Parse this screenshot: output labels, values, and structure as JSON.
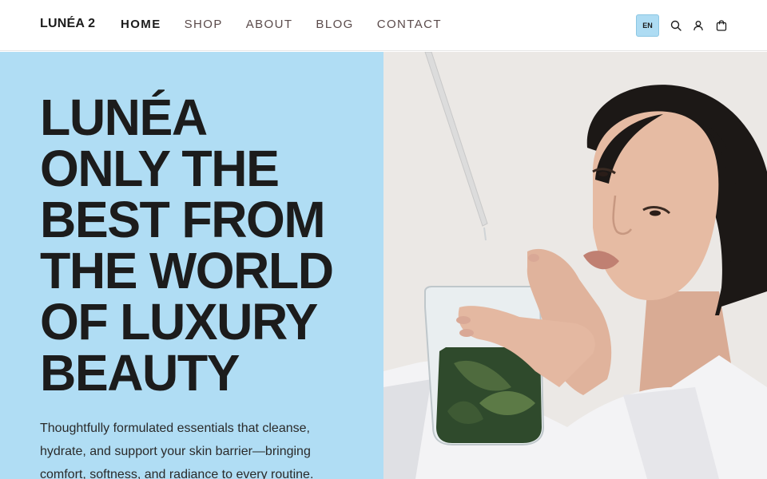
{
  "header": {
    "logo": "LUNÉA 2",
    "nav": [
      {
        "label": "HOME",
        "active": true
      },
      {
        "label": "SHOP",
        "active": false
      },
      {
        "label": "ABOUT",
        "active": false
      },
      {
        "label": "BLOG",
        "active": false
      },
      {
        "label": "CONTACT",
        "active": false
      }
    ],
    "language": "EN",
    "icons": [
      "search-icon",
      "account-icon",
      "cart-icon"
    ]
  },
  "hero": {
    "title_lines": [
      "LUNÉA",
      "ONLY THE",
      "BEST FROM",
      "THE WORLD",
      "OF LUXURY",
      "BEAUTY"
    ],
    "subtitle_lines": [
      "Thoughtfully formulated essentials that cleanse,",
      "hydrate, and support your skin barrier—bringing",
      "comfort, softness, and radiance to every routine."
    ],
    "image": "model-with-leaf-beaker-and-dropper"
  },
  "colors": {
    "accent": "#b0ddf4",
    "text": "#1c1c1c",
    "nav_text": "#5a4a4a"
  }
}
